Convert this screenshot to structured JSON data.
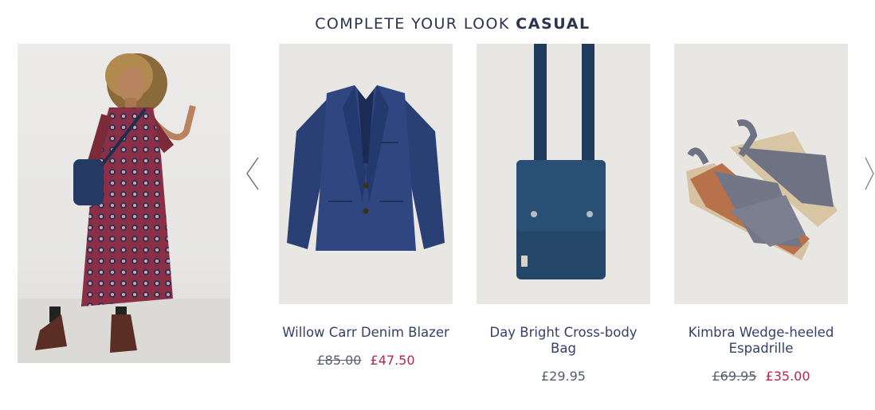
{
  "section": {
    "title_prefix": "COMPLETE YOUR LOOK",
    "title_emphasis": "CASUAL"
  },
  "carousel": {
    "prev_icon": "chevron-left-icon",
    "next_icon": "chevron-right-icon"
  },
  "products": [
    {
      "name": "Willow Carr Denim Blazer",
      "was_price": "£85.00",
      "price": "£47.50"
    },
    {
      "name": "Day Bright Cross-body Bag",
      "was_price": "",
      "price": "£29.95"
    },
    {
      "name": "Kimbra Wedge-heeled Espadrille",
      "was_price": "£69.95",
      "price": "£35.00"
    }
  ],
  "colors": {
    "navy_text": "#2b3450",
    "sale_red": "#b4254f",
    "denim": "#263a6b",
    "bag_blue": "#1f3f5e",
    "suede_grey": "#6f7384"
  }
}
